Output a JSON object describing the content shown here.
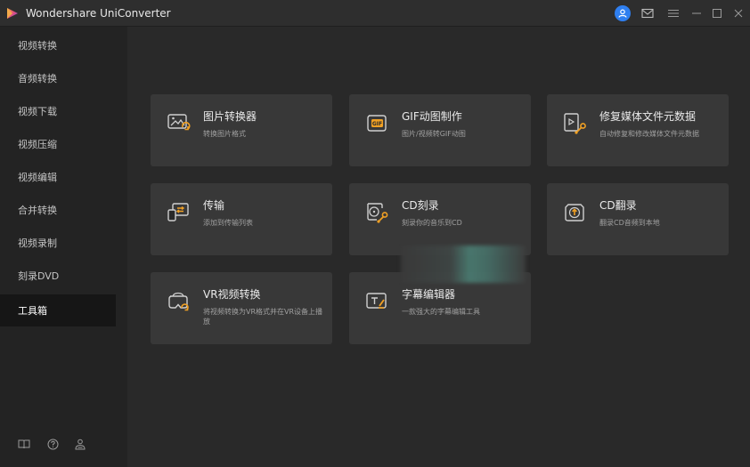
{
  "window": {
    "title": "Wondershare UniConverter"
  },
  "sidebar": {
    "items": [
      {
        "label": "视频转换"
      },
      {
        "label": "音频转换"
      },
      {
        "label": "视频下载"
      },
      {
        "label": "视频压缩"
      },
      {
        "label": "视频编辑"
      },
      {
        "label": "合并转换"
      },
      {
        "label": "视频录制"
      },
      {
        "label": "刻录DVD"
      },
      {
        "label": "工具箱",
        "active": true
      }
    ],
    "bottom_icons": [
      "book-icon",
      "help-icon",
      "user-group-icon"
    ]
  },
  "tools": [
    {
      "title": "图片转换器",
      "desc": "转换图片格式",
      "icon": "image-convert-icon"
    },
    {
      "title": "GIF动图制作",
      "desc": "图片/视频转GIF动图",
      "icon": "gif-icon"
    },
    {
      "title": "修复媒体文件元数据",
      "desc": "自动修复和修改媒体文件元数据",
      "icon": "metadata-fix-icon"
    },
    {
      "title": "传输",
      "desc": "添加到传输列表",
      "icon": "transfer-icon"
    },
    {
      "title": "CD刻录",
      "desc": "刻录你的音乐到CD",
      "icon": "cd-burn-icon"
    },
    {
      "title": "CD翻录",
      "desc": "翻录CD音频到本地",
      "icon": "cd-rip-icon"
    },
    {
      "title": "VR视频转换",
      "desc": "将视频转换为VR格式并在VR设备上播放",
      "icon": "vr-icon"
    },
    {
      "title": "字幕编辑器",
      "desc": "一款强大的字幕编辑工具",
      "icon": "subtitle-editor-icon"
    }
  ],
  "colors": {
    "accent": "#f0a024",
    "avatar": "#2f7ff0",
    "card": "#383838",
    "sidebar": "#232323"
  }
}
